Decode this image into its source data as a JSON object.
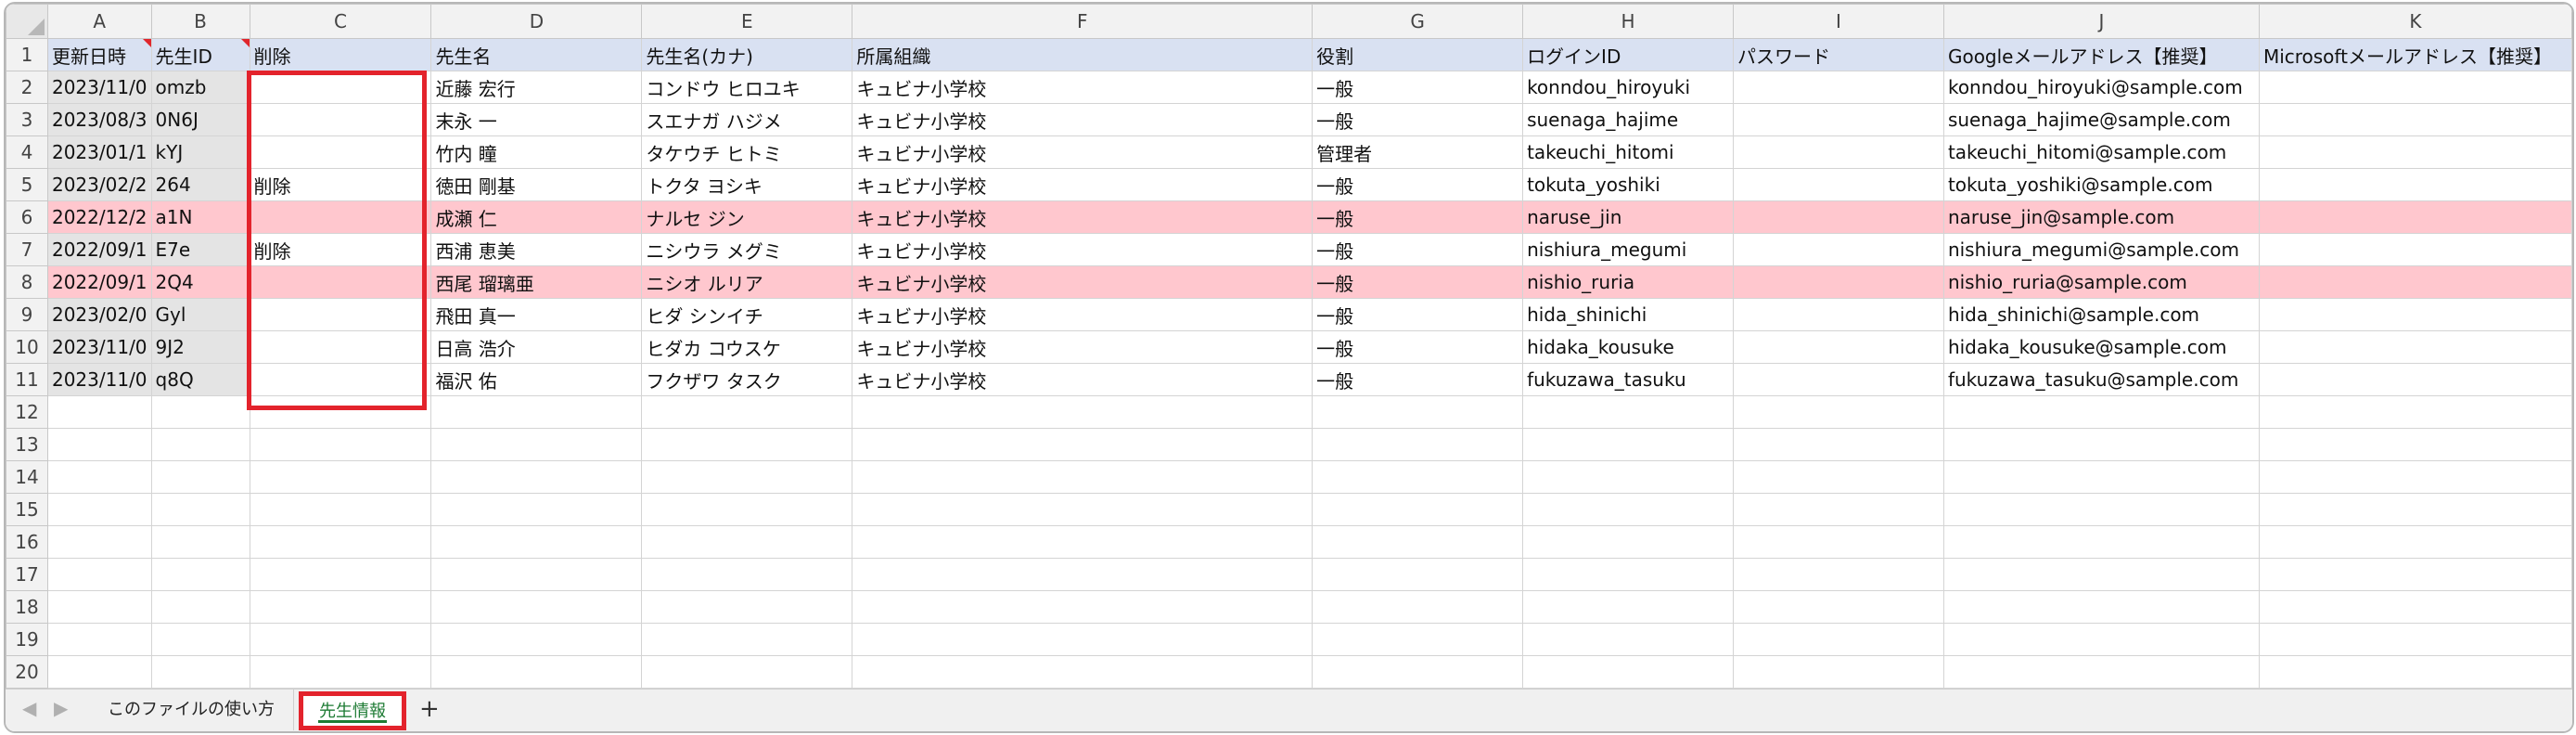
{
  "columns": [
    "A",
    "B",
    "C",
    "D",
    "E",
    "F",
    "G",
    "H",
    "I",
    "J",
    "K"
  ],
  "headers": [
    "更新日時",
    "先生ID",
    "削除",
    "先生名",
    "先生名(カナ)",
    "所属組織",
    "役割",
    "ログインID",
    "パスワード",
    "Googleメールアドレス【推奨】",
    "Microsoftメールアドレス【推奨】"
  ],
  "rows": [
    [
      "2023/11/0",
      "omzb",
      "",
      "近藤 宏行",
      "コンドウ ヒロユキ",
      "キュビナ小学校",
      "一般",
      "konndou_hiroyuki",
      "",
      "konndou_hiroyuki@sample.com",
      ""
    ],
    [
      "2023/08/3",
      "0N6J",
      "",
      "末永 一",
      "スエナガ ハジメ",
      "キュビナ小学校",
      "一般",
      "suenaga_hajime",
      "",
      "suenaga_hajime@sample.com",
      ""
    ],
    [
      "2023/01/1",
      "kYJ",
      "",
      "竹内 瞳",
      "タケウチ ヒトミ",
      "キュビナ小学校",
      "管理者",
      "takeuchi_hitomi",
      "",
      "takeuchi_hitomi@sample.com",
      ""
    ],
    [
      "2023/02/2",
      "264",
      "削除",
      "徳田 剛基",
      "トクタ ヨシキ",
      "キュビナ小学校",
      "一般",
      "tokuta_yoshiki",
      "",
      "tokuta_yoshiki@sample.com",
      ""
    ],
    [
      "2022/12/2",
      "a1N",
      "",
      "成瀬 仁",
      "ナルセ ジン",
      "キュビナ小学校",
      "一般",
      "naruse_jin",
      "",
      "naruse_jin@sample.com",
      ""
    ],
    [
      "2022/09/1",
      "E7e",
      "削除",
      "西浦 恵美",
      "ニシウラ メグミ",
      "キュビナ小学校",
      "一般",
      "nishiura_megumi",
      "",
      "nishiura_megumi@sample.com",
      ""
    ],
    [
      "2022/09/1",
      "2Q4",
      "",
      "西尾 瑠璃亜",
      "ニシオ ルリア",
      "キュビナ小学校",
      "一般",
      "nishio_ruria",
      "",
      "nishio_ruria@sample.com",
      ""
    ],
    [
      "2023/02/0",
      "Gyl",
      "",
      "飛田 真一",
      "ヒダ シンイチ",
      "キュビナ小学校",
      "一般",
      "hida_shinichi",
      "",
      "hida_shinichi@sample.com",
      ""
    ],
    [
      "2023/11/0",
      "9J2",
      "",
      "日高 浩介",
      "ヒダカ コウスケ",
      "キュビナ小学校",
      "一般",
      "hidaka_kousuke",
      "",
      "hidaka_kousuke@sample.com",
      ""
    ],
    [
      "2023/11/0",
      "q8Q",
      "",
      "福沢 佑",
      "フクザワ タスク",
      "キュビナ小学校",
      "一般",
      "fukuzawa_tasuku",
      "",
      "fukuzawa_tasuku@sample.com",
      ""
    ]
  ],
  "highlighted_rows": [
    4,
    6
  ],
  "row_numbers": [
    "1",
    "2",
    "3",
    "4",
    "5",
    "6",
    "7",
    "8",
    "9",
    "10",
    "11",
    "12",
    "13",
    "14",
    "15",
    "16",
    "17",
    "18",
    "19",
    "20"
  ],
  "sheet_tabs": {
    "first": "このファイルの使い方",
    "active": "先生情報",
    "add": "+"
  },
  "nav": {
    "prev": "◀",
    "next": "▶"
  },
  "colors": {
    "header_fill": "#d9e1f2",
    "deleted_row_fill": "#ffc7ce",
    "locked_fill": "#e4e4e4",
    "annotation_red": "#e3232c",
    "active_tab_text": "#1e7b34"
  }
}
